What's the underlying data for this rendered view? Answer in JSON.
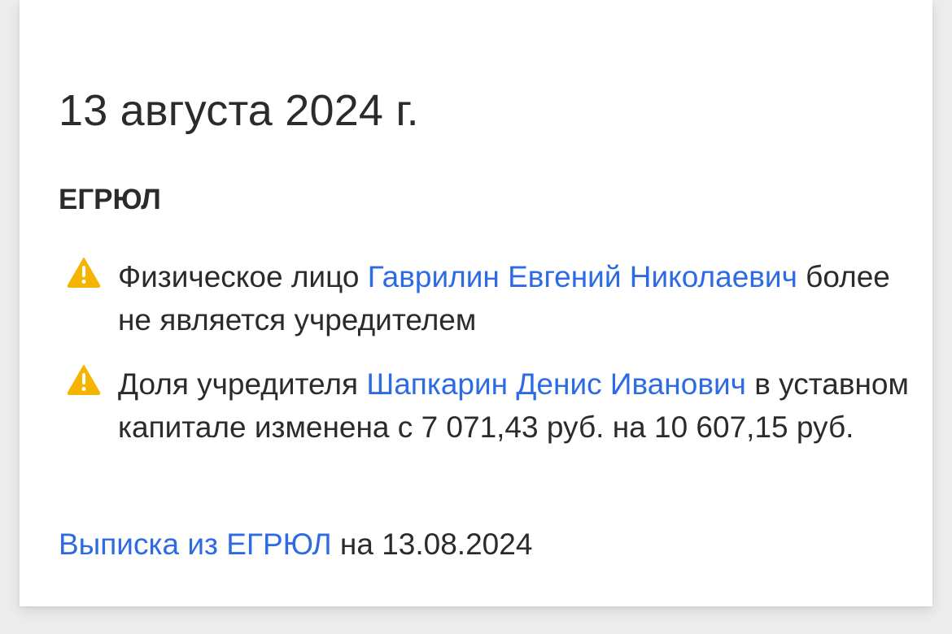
{
  "date_heading": "13 августа 2024 г.",
  "section_title": "ЕГРЮЛ",
  "events": [
    {
      "icon": "warning-icon",
      "text_before": "Физическое лицо ",
      "link_text": "Гаврилин Евгений Николаевич",
      "text_after": " более не является учредителем"
    },
    {
      "icon": "warning-icon",
      "text_before": "Доля учредителя ",
      "link_text": "Шапкарин Денис Иванович",
      "text_after": " в уставном капитале изменена с 7 071,43 руб. на 10 607,15 руб."
    }
  ],
  "extract": {
    "link_text": "Выписка из ЕГРЮЛ",
    "text_after": " на 13.08.2024"
  },
  "colors": {
    "link": "#2d6be4",
    "warning": "#f5b400",
    "text": "#2b2b2b",
    "card_background": "#ffffff",
    "page_background": "#ececec"
  }
}
